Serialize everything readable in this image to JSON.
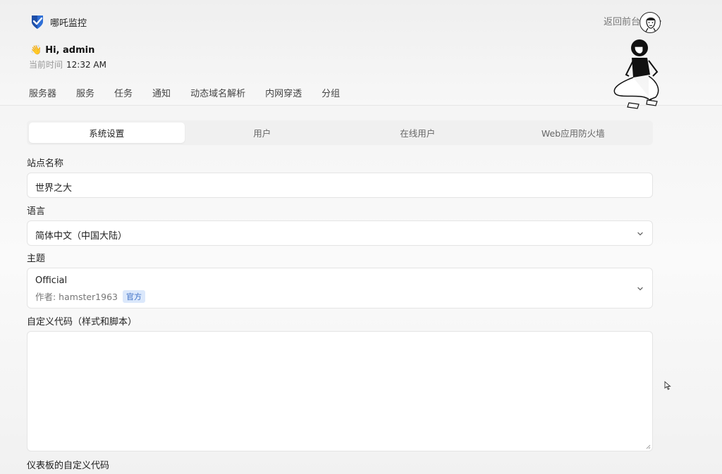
{
  "app": {
    "name": "哪吒监控"
  },
  "header": {
    "greeting": "Hi, admin",
    "greeting_emoji": "👋",
    "time_label": "当前时间",
    "time_value": "12:32 AM",
    "back_label": "返回前台"
  },
  "nav": {
    "items": [
      "服务器",
      "服务",
      "任务",
      "通知",
      "动态域名解析",
      "内网穿透",
      "分组"
    ]
  },
  "tabs": [
    "系统设置",
    "用户",
    "在线用户",
    "Web应用防火墙"
  ],
  "form": {
    "site_name_label": "站点名称",
    "site_name_value": "世界之大",
    "language_label": "语言",
    "language_value": "简体中文（中国大陆）",
    "theme_label": "主题",
    "theme_value": "Official",
    "theme_author": "作者: hamster1963",
    "theme_badge": "官方",
    "custom_code_label": "自定义代码（样式和脚本）",
    "dashboard_code_label": "仪表板的自定义代码"
  },
  "colors": {
    "logo_blue": "#2f6fd6",
    "badge_bg": "#dbe8fb",
    "badge_text": "#3d6fc5"
  }
}
